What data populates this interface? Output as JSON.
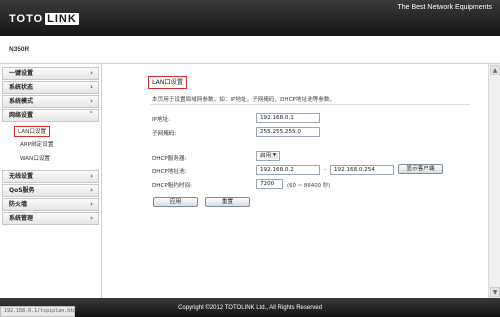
{
  "header": {
    "logo_part1": "TOTO",
    "logo_part2": "LINK",
    "slogan": "The Best Network Equipments",
    "model": "N350R"
  },
  "sidebar": {
    "items": [
      {
        "label": "一键设置",
        "expanded": false
      },
      {
        "label": "系统状态",
        "expanded": false
      },
      {
        "label": "系统模式",
        "expanded": false
      },
      {
        "label": "网络设置",
        "expanded": true
      }
    ],
    "network_subitems": [
      {
        "label": "LAN口设置",
        "active": true
      },
      {
        "label": "ARP绑定设置",
        "active": false
      },
      {
        "label": "WAN口设置",
        "active": false
      }
    ],
    "items_after": [
      {
        "label": "无线设置"
      },
      {
        "label": "QoS服务"
      },
      {
        "label": "防火墙"
      },
      {
        "label": "系统管理"
      }
    ]
  },
  "page": {
    "title": "LAN口设置",
    "description": "本页用于设置局域网参数，如：IP地址，子网掩码，DHCP地址池等参数。"
  },
  "form": {
    "ip_label": "IP地址:",
    "ip_value": "192.168.0.1",
    "subnet_label": "子网掩码:",
    "subnet_value": "255.255.255.0",
    "dhcp_server_label": "DHCP服务器:",
    "dhcp_server_value": "启用",
    "dhcp_pool_label": "DHCP地址池:",
    "dhcp_pool_start": "192.168.0.2",
    "dhcp_pool_sep": "-",
    "dhcp_pool_end": "192.168.0.254",
    "show_clients_button": "显示客户端",
    "lease_label": "DHCP租约时间:",
    "lease_value": "7200",
    "lease_hint": "(60 ~ 86400 秒)",
    "apply_button": "应用",
    "reset_button": "重置"
  },
  "footer": {
    "copyright": "Copyright ©2012 TOTOLINK Ltd., All Rights Reserved",
    "status_url": "192.168.0.1/tcpiplan.htm"
  }
}
